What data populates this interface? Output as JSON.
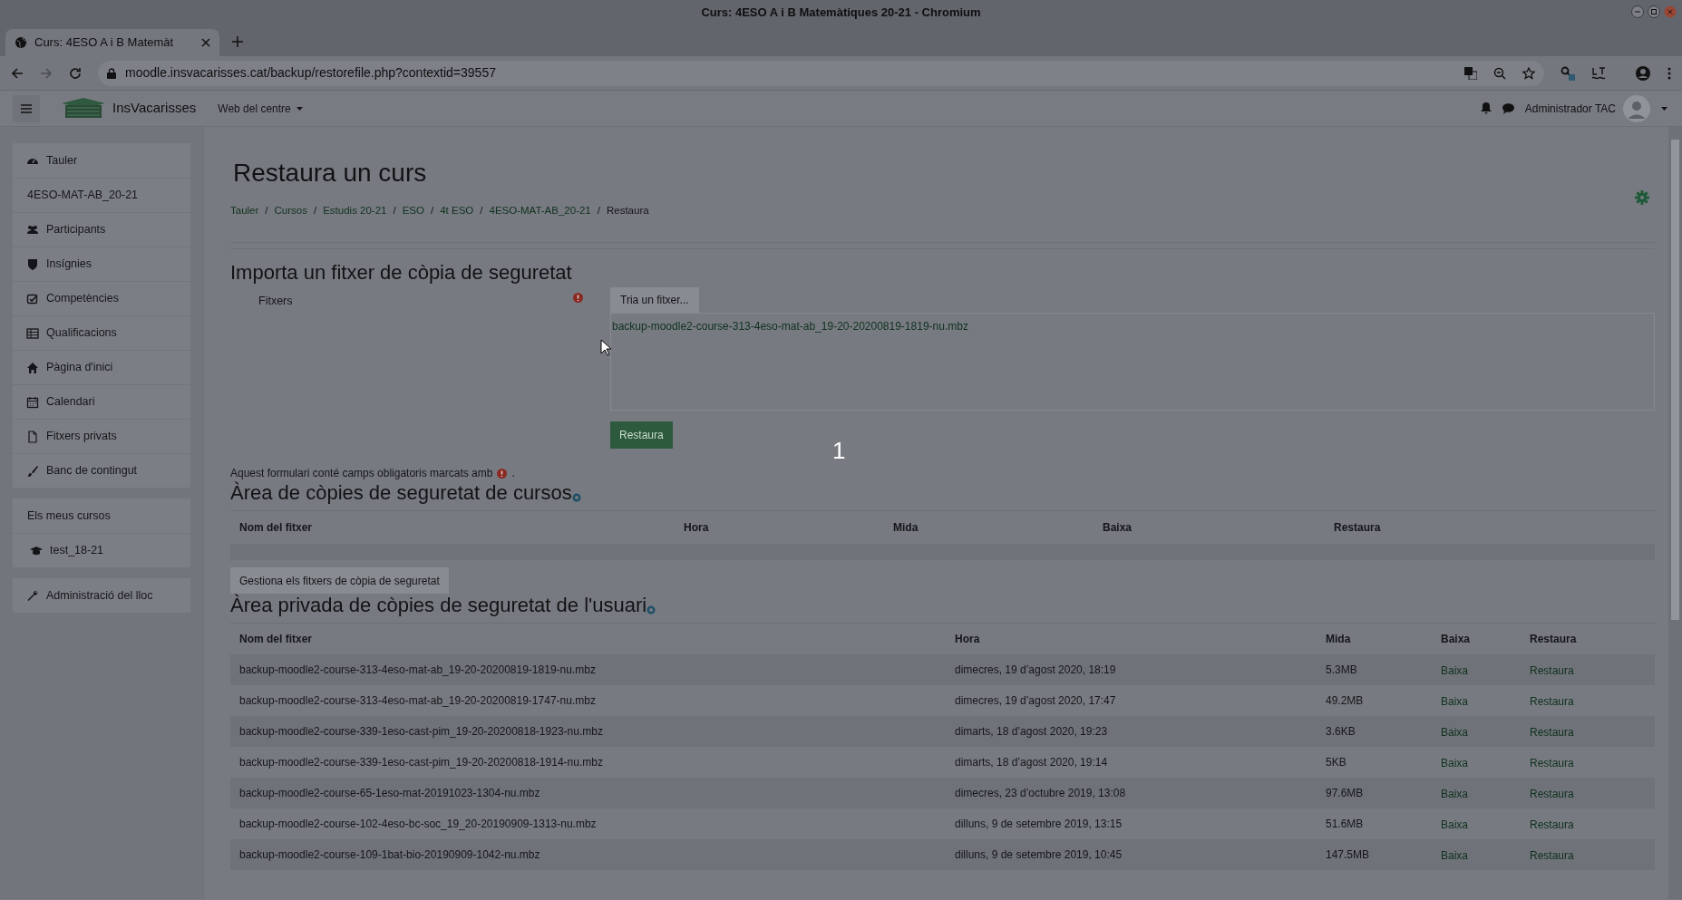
{
  "window": {
    "title": "Curs: 4ESO A i B Matemàtiques 20-21 - Chromium"
  },
  "browser": {
    "tabs": [
      {
        "label": "Curs: 4ESO A i B Matemàt",
        "selected": true
      }
    ],
    "address": "moodle.insvacarisses.cat/backup/restorefile.php?contextid=39557"
  },
  "navbar": {
    "site_name": "InsVacarisses",
    "menu": "Web del centre",
    "user": "Administrador TAC"
  },
  "sidebar": {
    "groups": [
      {
        "items": [
          {
            "label": "Tauler",
            "kind": "link"
          },
          {
            "label": "4ESO-MAT-AB_20-21",
            "kind": "heading"
          },
          {
            "label": "Participants",
            "kind": "link"
          },
          {
            "label": "Insígnies",
            "kind": "link"
          },
          {
            "label": "Competències",
            "kind": "link"
          },
          {
            "label": "Qualificacions",
            "kind": "link"
          },
          {
            "label": "Pàgina d'inici",
            "kind": "link"
          },
          {
            "label": "Calendari",
            "kind": "link"
          },
          {
            "label": "Fitxers privats",
            "kind": "link"
          },
          {
            "label": "Banc de contingut",
            "kind": "link"
          }
        ]
      },
      {
        "items": [
          {
            "label": "Els meus cursos",
            "kind": "heading"
          },
          {
            "label": "test_18-21",
            "kind": "link"
          }
        ]
      },
      {
        "items": [
          {
            "label": "Administració del lloc",
            "kind": "link"
          }
        ]
      }
    ]
  },
  "page": {
    "title": "Restaura un curs",
    "breadcrumb_separator": "/",
    "breadcrumb": [
      "Tauler",
      "Cursos",
      "Estudis 20-21",
      "ESO",
      "4t ESO",
      "4ESO-MAT-AB_20-21",
      "Restaura"
    ]
  },
  "import": {
    "heading": "Importa un fitxer de còpia de seguretat",
    "field_label": "Fitxers",
    "choose_button": "Tria un fitxer...",
    "file": "backup-moodle2-course-313-4eso-mat-ab_19-20-20200819-1819-nu.mbz",
    "submit": "Restaura",
    "note": "Aquest formulari conté camps obligatoris marcats amb",
    "note_end": "."
  },
  "step_marker": "1",
  "course_area": {
    "heading": "Àrea de còpies de seguretat de cursos",
    "columns": [
      "Nom del fitxer",
      "Hora",
      "Mida",
      "Baixa",
      "Restaura"
    ],
    "manage_button": "Gestiona els fitxers de còpia de seguretat"
  },
  "user_area": {
    "heading": "Àrea privada de còpies de seguretat de l'usuari",
    "columns": [
      "Nom del fitxer",
      "Hora",
      "Mida",
      "Baixa",
      "Restaura"
    ],
    "rows": [
      {
        "name": "backup-moodle2-course-313-4eso-mat-ab_19-20-20200819-1819-nu.mbz",
        "time": "dimecres, 19 d’agost 2020, 18:19",
        "size": "5.3MB",
        "download": "Baixa",
        "restore": "Restaura"
      },
      {
        "name": "backup-moodle2-course-313-4eso-mat-ab_19-20-20200819-1747-nu.mbz",
        "time": "dimecres, 19 d’agost 2020, 17:47",
        "size": "49.2MB",
        "download": "Baixa",
        "restore": "Restaura"
      },
      {
        "name": "backup-moodle2-course-339-1eso-cast-pim_19-20-20200818-1923-nu.mbz",
        "time": "dimarts, 18 d’agost 2020, 19:23",
        "size": "3.6KB",
        "download": "Baixa",
        "restore": "Restaura"
      },
      {
        "name": "backup-moodle2-course-339-1eso-cast-pim_19-20-20200818-1914-nu.mbz",
        "time": "dimarts, 18 d’agost 2020, 19:14",
        "size": "5KB",
        "download": "Baixa",
        "restore": "Restaura"
      },
      {
        "name": "backup-moodle2-course-65-1eso-mat-20191023-1304-nu.mbz",
        "time": "dimecres, 23 d’octubre 2019, 13:08",
        "size": "97.6MB",
        "download": "Baixa",
        "restore": "Restaura"
      },
      {
        "name": "backup-moodle2-course-102-4eso-bc-soc_19_20-20190909-1313-nu.mbz",
        "time": "dilluns, 9 de setembre 2019, 13:15",
        "size": "51.6MB",
        "download": "Baixa",
        "restore": "Restaura"
      },
      {
        "name": "backup-moodle2-course-109-1bat-bio-20190909-1042-nu.mbz",
        "time": "dilluns, 9 de setembre 2019, 10:45",
        "size": "147.5MB",
        "download": "Baixa",
        "restore": "Restaura"
      }
    ]
  }
}
